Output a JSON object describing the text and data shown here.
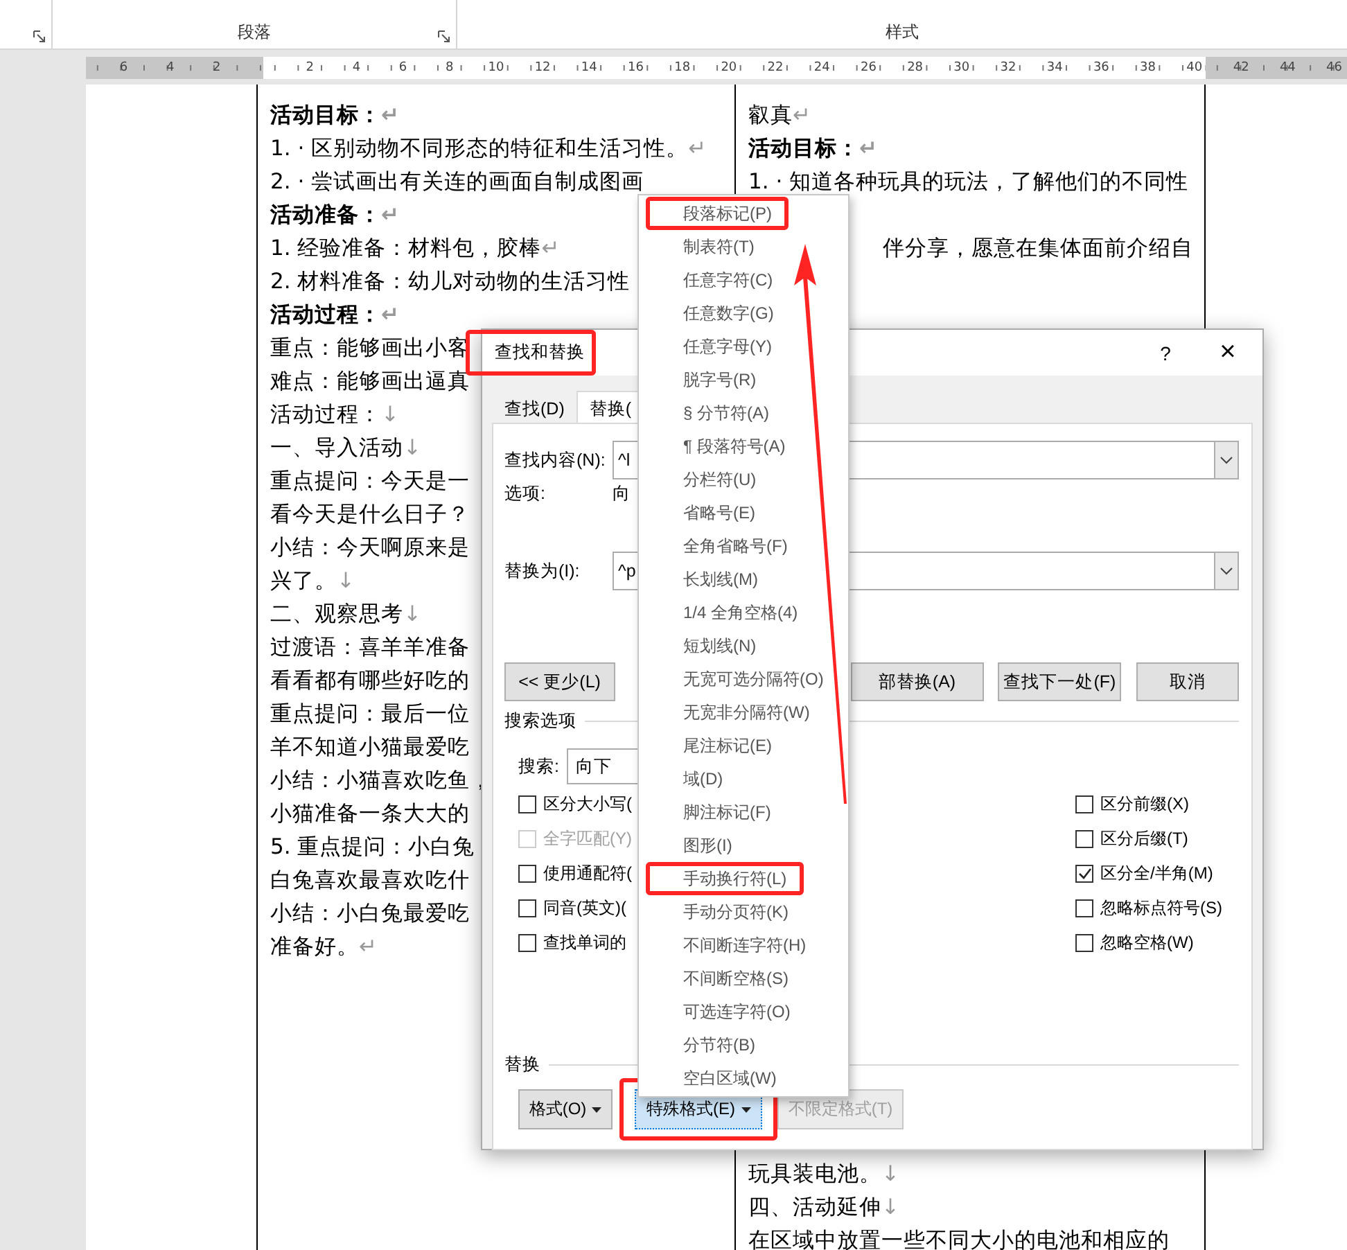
{
  "ribbon": {
    "groups": [
      {
        "launcher": true
      },
      {
        "label": "段落",
        "launcher": true
      },
      {
        "label": "样式",
        "launcher": false
      }
    ]
  },
  "ruler": {
    "left_labels": [
      "6",
      "4",
      "2"
    ],
    "main_labels": [
      "2",
      "4",
      "6",
      "8",
      "10",
      "12",
      "14",
      "16",
      "18",
      "20",
      "22",
      "24",
      "26",
      "28",
      "30",
      "32",
      "34",
      "36",
      "38",
      "40"
    ],
    "right_labels": [
      "42",
      "44",
      "46"
    ]
  },
  "document": {
    "left_column": [
      {
        "text": "活动目标：",
        "bold": true,
        "mark": "↵"
      },
      {
        "text": "1. · 区别动物不同形态的特征和生活习性。",
        "bold": false,
        "mark": "↵"
      },
      {
        "text": "2. · 尝试画出有关连的画面自制成图画",
        "bold": false
      },
      {
        "text": "活动准备：",
        "bold": true,
        "mark": "↵"
      },
      {
        "text": "1. 经验准备：材料包，胶棒",
        "bold": false,
        "mark": "↵"
      },
      {
        "text": "2. 材料准备：幼儿对动物的生活习性",
        "bold": false
      },
      {
        "text": "活动过程：",
        "bold": true,
        "mark": "↵"
      },
      {
        "text": "重点：能够画出小客",
        "bold": false
      },
      {
        "text": "难点：能够画出逼真",
        "bold": false
      },
      {
        "text": "活动过程：",
        "bold": false,
        "mark": "↓"
      },
      {
        "text": "一、导入活动",
        "bold": false,
        "mark": "↓"
      },
      {
        "text": "重点提问：今天是一",
        "bold": false
      },
      {
        "text": "看今天是什么日子？",
        "bold": false
      },
      {
        "text": "小结：今天啊原来是",
        "bold": false
      },
      {
        "text": "兴了。",
        "bold": false,
        "mark": "↓"
      },
      {
        "text": "二、观察思考",
        "bold": false,
        "mark": "↓"
      },
      {
        "text": "过渡语：喜羊羊准备",
        "bold": false
      },
      {
        "text": "看看都有哪些好吃的",
        "bold": false
      },
      {
        "text": "重点提问：最后一位",
        "bold": false
      },
      {
        "text": "羊不知道小猫最爱吃",
        "bold": false
      },
      {
        "text": "小结：小猫喜欢吃鱼，",
        "bold": false
      },
      {
        "text": "小猫准备一条大大的",
        "bold": false
      },
      {
        "text": "5. 重点提问：小白兔",
        "bold": false
      },
      {
        "text": "白兔喜欢最喜欢吃什",
        "bold": false
      },
      {
        "text": "小结：小白兔最爱吃",
        "bold": false
      },
      {
        "text": "准备好。",
        "bold": false,
        "mark": "↵"
      }
    ],
    "right_column_top": [
      {
        "text": "叡真",
        "bold": false,
        "mark": "↵"
      },
      {
        "text": "活动目标：",
        "bold": true,
        "mark": "↵"
      },
      {
        "text": "1. · 知道各种玩具的玩法，了解他们的不同性",
        "bold": false
      },
      {
        "text": "伴分享，愿意在集体面前介绍自",
        "bold": false,
        "kind": "tail"
      }
    ],
    "right_column_bottom": [
      {
        "text": "玩具装电池。",
        "bold": false,
        "mark": "↓"
      },
      {
        "text": "四、活动延伸",
        "bold": false,
        "mark": "↓"
      },
      {
        "text": "在区域中放置一些不同大小的电池和相应的",
        "bold": false
      }
    ]
  },
  "dialog": {
    "title": "查找和替换",
    "title_highlighted": true,
    "help": "?",
    "close": "×",
    "tabs": [
      {
        "label": "查找(D)",
        "selected": false
      },
      {
        "label": "替换(",
        "selected": true
      }
    ],
    "find": {
      "label": "查找内容(N):",
      "value": "^l"
    },
    "options": {
      "label": "选项:",
      "value": "向"
    },
    "replace": {
      "label": "替换为(I):",
      "value": "^p"
    },
    "actions": [
      {
        "label": "<< 更少(L)"
      },
      {
        "label": "部替换(A)"
      },
      {
        "label": "查找下一处(F)"
      },
      {
        "label": "取消"
      }
    ],
    "search_options": {
      "title": "搜索选项",
      "search_label": "搜索:",
      "search_value": "向下",
      "left": [
        {
          "label": "区分大小写(",
          "checked": false,
          "disabled": false
        },
        {
          "label": "全字匹配(Y)",
          "checked": false,
          "disabled": true
        },
        {
          "label": "使用通配符(",
          "checked": false,
          "disabled": false
        },
        {
          "label": "同音(英文)(",
          "checked": false,
          "disabled": false
        },
        {
          "label": "查找单词的",
          "checked": false,
          "disabled": false
        }
      ],
      "right": [
        {
          "label": "区分前缀(X)",
          "checked": false,
          "disabled": false
        },
        {
          "label": "区分后缀(T)",
          "checked": false,
          "disabled": false
        },
        {
          "label": "区分全/半角(M)",
          "checked": true,
          "disabled": false
        },
        {
          "label": "忽略标点符号(S)",
          "checked": false,
          "disabled": false
        },
        {
          "label": "忽略空格(W)",
          "checked": false,
          "disabled": false
        }
      ]
    },
    "replace_section": {
      "title": "替换",
      "buttons": [
        {
          "label": "格式(O)",
          "dropdown": true,
          "selected": false,
          "disabled": false,
          "highlighted": false
        },
        {
          "label": "特殊格式(E)",
          "dropdown": true,
          "selected": true,
          "disabled": false,
          "highlighted": true
        },
        {
          "label": "不限定格式(T)",
          "dropdown": false,
          "selected": false,
          "disabled": true,
          "highlighted": false
        }
      ]
    }
  },
  "special_menu": {
    "items": [
      {
        "label": "段落标记(P)",
        "highlighted": true
      },
      {
        "label": "制表符(T)",
        "highlighted": false
      },
      {
        "label": "任意字符(C)",
        "highlighted": false
      },
      {
        "label": "任意数字(G)",
        "highlighted": false
      },
      {
        "label": "任意字母(Y)",
        "highlighted": false
      },
      {
        "label": "脱字号(R)",
        "highlighted": false
      },
      {
        "label": "§ 分节符(A)",
        "highlighted": false
      },
      {
        "label": "¶ 段落符号(A)",
        "highlighted": false
      },
      {
        "label": "分栏符(U)",
        "highlighted": false
      },
      {
        "label": "省略号(E)",
        "highlighted": false
      },
      {
        "label": "全角省略号(F)",
        "highlighted": false
      },
      {
        "label": "长划线(M)",
        "highlighted": false
      },
      {
        "label": "1/4 全角空格(4)",
        "highlighted": false
      },
      {
        "label": "短划线(N)",
        "highlighted": false
      },
      {
        "label": "无宽可选分隔符(O)",
        "highlighted": false
      },
      {
        "label": "无宽非分隔符(W)",
        "highlighted": false
      },
      {
        "label": "尾注标记(E)",
        "highlighted": false
      },
      {
        "label": "域(D)",
        "highlighted": false
      },
      {
        "label": "脚注标记(F)",
        "highlighted": false
      },
      {
        "label": "图形(I)",
        "highlighted": false
      },
      {
        "label": "手动换行符(L)",
        "highlighted": true
      },
      {
        "label": "手动分页符(K)",
        "highlighted": false
      },
      {
        "label": "不间断连字符(H)",
        "highlighted": false
      },
      {
        "label": "不间断空格(S)",
        "highlighted": false
      },
      {
        "label": "可选连字符(O)",
        "highlighted": false
      },
      {
        "label": "分节符(B)",
        "highlighted": false
      },
      {
        "label": "空白区域(W)",
        "highlighted": false
      }
    ]
  }
}
